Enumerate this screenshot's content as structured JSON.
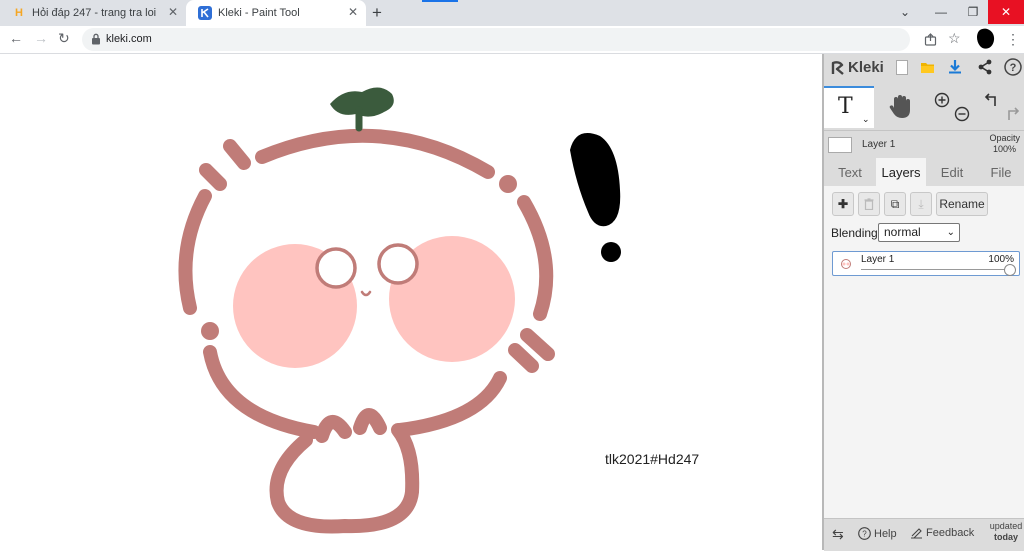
{
  "browser": {
    "tabs": [
      {
        "title": "Hỏi đáp 247 - trang tra loi",
        "favicon": "h-logo",
        "active": false
      },
      {
        "title": "Kleki - Paint Tool",
        "favicon": "kleki-logo",
        "active": true
      }
    ],
    "new_tab_glyph": "+",
    "url": "kleki.com",
    "window_controls": {
      "dropdown": "⌄",
      "minimize": "—",
      "restore": "❐",
      "close": "✕"
    }
  },
  "canvas": {
    "watermark_text": "tlk2021#Hd247",
    "colors": {
      "outline": "#c07c78",
      "cheeks": "#ffc4c0",
      "leaf": "#3b5b3d",
      "exclamation": "#000000",
      "background": "#ffffff"
    }
  },
  "kleki": {
    "logo": "Kleki",
    "toolbar_icons": [
      "new-image-icon",
      "open-folder-icon",
      "download-icon",
      "share-icon",
      "help-icon"
    ],
    "tools": [
      {
        "name": "text-tool",
        "label": "T",
        "active": true
      },
      {
        "name": "hand-tool"
      },
      {
        "name": "zoom-in"
      },
      {
        "name": "zoom-out"
      },
      {
        "name": "undo"
      },
      {
        "name": "redo"
      }
    ],
    "current_layer": {
      "name": "Layer 1",
      "opacity_label": "Opacity",
      "opacity_value": "100%"
    },
    "panel_tabs": [
      "Text",
      "Layers",
      "Edit",
      "File"
    ],
    "active_panel_tab": "Layers",
    "layer_buttons": {
      "add": "✚",
      "delete": "🗑",
      "duplicate": "⧉",
      "merge": "⤓",
      "rename": "Rename"
    },
    "blending": {
      "label": "Blending",
      "value": "normal"
    },
    "layers": [
      {
        "name": "Layer 1",
        "opacity": "100%"
      }
    ],
    "bottom": {
      "swap_glyph": "⇆",
      "help": "Help",
      "feedback": "Feedback",
      "updated_line1": "updated",
      "updated_line2": "today"
    },
    "accent": "#3c8cdc"
  }
}
